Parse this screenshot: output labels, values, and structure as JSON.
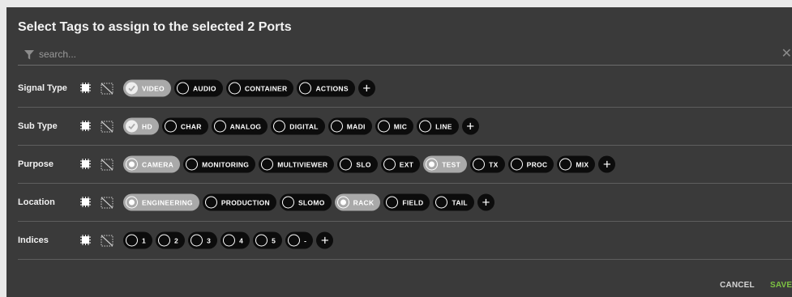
{
  "dialog": {
    "title": "Select Tags to assign to the selected 2 Ports",
    "search_placeholder": "search...",
    "clear_glyph": "✕",
    "plus_glyph": "+",
    "cancel_label": "CANCEL",
    "save_label": "SAVE",
    "colors": {
      "background": "#3a3a3a",
      "chip": "#0c0c0c",
      "chip_selected": "#a9a9a9",
      "save": "#7dc242",
      "cancel": "#d6d6d6"
    }
  },
  "groups": [
    {
      "label": "Signal Type",
      "tags": [
        {
          "label": "VIDEO",
          "selected": true,
          "mark": "check"
        },
        {
          "label": "AUDIO",
          "selected": false
        },
        {
          "label": "CONTAINER",
          "selected": false
        },
        {
          "label": "ACTIONS",
          "selected": false
        }
      ]
    },
    {
      "label": "Sub Type",
      "tags": [
        {
          "label": "HD",
          "selected": true,
          "mark": "check"
        },
        {
          "label": "CHAR",
          "selected": false
        },
        {
          "label": "ANALOG",
          "selected": false
        },
        {
          "label": "DIGITAL",
          "selected": false
        },
        {
          "label": "MADI",
          "selected": false
        },
        {
          "label": "MIC",
          "selected": false
        },
        {
          "label": "LINE",
          "selected": false
        }
      ]
    },
    {
      "label": "Purpose",
      "tags": [
        {
          "label": "CAMERA",
          "selected": true,
          "mark": "dot"
        },
        {
          "label": "MONITORING",
          "selected": false
        },
        {
          "label": "MULTIVIEWER",
          "selected": false
        },
        {
          "label": "SLO",
          "selected": false
        },
        {
          "label": "EXT",
          "selected": false
        },
        {
          "label": "TEST",
          "selected": true,
          "mark": "dot"
        },
        {
          "label": "TX",
          "selected": false
        },
        {
          "label": "PROC",
          "selected": false
        },
        {
          "label": "MIX",
          "selected": false
        }
      ]
    },
    {
      "label": "Location",
      "tags": [
        {
          "label": "ENGINEERING",
          "selected": true,
          "mark": "dot"
        },
        {
          "label": "PRODUCTION",
          "selected": false
        },
        {
          "label": "SLOMO",
          "selected": false
        },
        {
          "label": "RACK",
          "selected": true,
          "mark": "dot"
        },
        {
          "label": "FIELD",
          "selected": false
        },
        {
          "label": "TAIL",
          "selected": false
        }
      ]
    },
    {
      "label": "Indices",
      "tags": [
        {
          "label": "1",
          "selected": false
        },
        {
          "label": "2",
          "selected": false
        },
        {
          "label": "3",
          "selected": false
        },
        {
          "label": "4",
          "selected": false
        },
        {
          "label": "5",
          "selected": false
        },
        {
          "label": "-",
          "selected": false
        }
      ]
    }
  ]
}
